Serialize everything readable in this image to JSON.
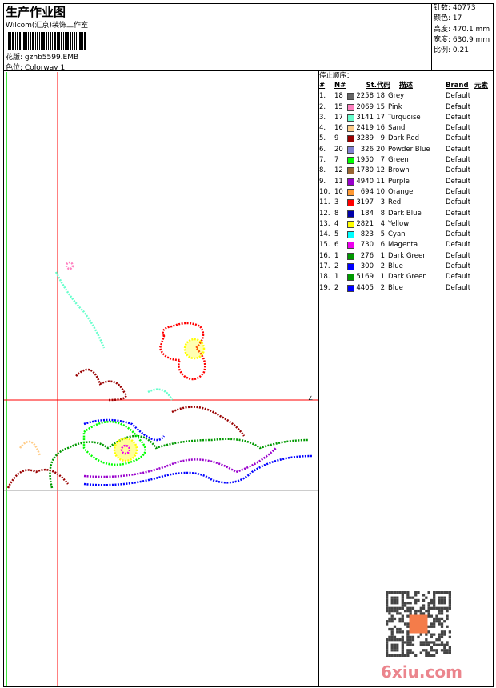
{
  "header": {
    "title": "生产作业图",
    "company": "Wilcom(汇京)装饰工作室",
    "file_label": "花版:",
    "file": "gzhb5599.EMB",
    "colorway_label": "色位:",
    "colorway": "Colorway 1"
  },
  "info": [
    {
      "label": "针数:",
      "value": "40773"
    },
    {
      "label": "颜色:",
      "value": "17"
    },
    {
      "label": "高度:",
      "value": "470.1 mm"
    },
    {
      "label": "宽度:",
      "value": "630.9 mm"
    },
    {
      "label": "比例:",
      "value": "0.21"
    }
  ],
  "stop_sequence": {
    "caption": "停止顺序：",
    "headers": {
      "num": "#",
      "n": "N#",
      "st": "St.",
      "code": "代码",
      "desc": "描述",
      "brand": "Brand",
      "element": "元素"
    },
    "rows": [
      {
        "num": "1.",
        "n": "18",
        "color": "#666666",
        "st": "2258",
        "code": "18",
        "desc": "Grey",
        "brand": "Default"
      },
      {
        "num": "2.",
        "n": "15",
        "color": "#ff80c0",
        "st": "2069",
        "code": "15",
        "desc": "Pink",
        "brand": "Default"
      },
      {
        "num": "3.",
        "n": "17",
        "color": "#66ffcc",
        "st": "3141",
        "code": "17",
        "desc": "Turquoise",
        "brand": "Default"
      },
      {
        "num": "4.",
        "n": "16",
        "color": "#ffcc88",
        "st": "2419",
        "code": "16",
        "desc": "Sand",
        "brand": "Default"
      },
      {
        "num": "5.",
        "n": "9",
        "color": "#990000",
        "st": "3289",
        "code": "9",
        "desc": "Dark Red",
        "brand": "Default"
      },
      {
        "num": "6.",
        "n": "20",
        "color": "#8080d0",
        "st": "326",
        "code": "20",
        "desc": "Powder Blue",
        "brand": "Default"
      },
      {
        "num": "7.",
        "n": "7",
        "color": "#00ff00",
        "st": "1950",
        "code": "7",
        "desc": "Green",
        "brand": "Default"
      },
      {
        "num": "8.",
        "n": "12",
        "color": "#996633",
        "st": "1780",
        "code": "12",
        "desc": "Brown",
        "brand": "Default"
      },
      {
        "num": "9.",
        "n": "11",
        "color": "#9900cc",
        "st": "4940",
        "code": "11",
        "desc": "Purple",
        "brand": "Default"
      },
      {
        "num": "10.",
        "n": "10",
        "color": "#ff9933",
        "st": "694",
        "code": "10",
        "desc": "Orange",
        "brand": "Default"
      },
      {
        "num": "11.",
        "n": "3",
        "color": "#ff0000",
        "st": "3197",
        "code": "3",
        "desc": "Red",
        "brand": "Default"
      },
      {
        "num": "12.",
        "n": "8",
        "color": "#0000aa",
        "st": "184",
        "code": "8",
        "desc": "Dark Blue",
        "brand": "Default"
      },
      {
        "num": "13.",
        "n": "4",
        "color": "#ffff00",
        "st": "2821",
        "code": "4",
        "desc": "Yellow",
        "brand": "Default"
      },
      {
        "num": "14.",
        "n": "5",
        "color": "#00ffff",
        "st": "823",
        "code": "5",
        "desc": "Cyan",
        "brand": "Default"
      },
      {
        "num": "15.",
        "n": "6",
        "color": "#ee00ee",
        "st": "730",
        "code": "6",
        "desc": "Magenta",
        "brand": "Default"
      },
      {
        "num": "16.",
        "n": "1",
        "color": "#009900",
        "st": "276",
        "code": "1",
        "desc": "Dark Green",
        "brand": "Default"
      },
      {
        "num": "17.",
        "n": "2",
        "color": "#0000ff",
        "st": "300",
        "code": "2",
        "desc": "Blue",
        "brand": "Default"
      },
      {
        "num": "18.",
        "n": "1",
        "color": "#009900",
        "st": "5169",
        "code": "1",
        "desc": "Dark Green",
        "brand": "Default"
      },
      {
        "num": "19.",
        "n": "2",
        "color": "#0000ff",
        "st": "4405",
        "code": "2",
        "desc": "Blue",
        "brand": "Default"
      }
    ]
  },
  "watermark": "6xiu.com"
}
